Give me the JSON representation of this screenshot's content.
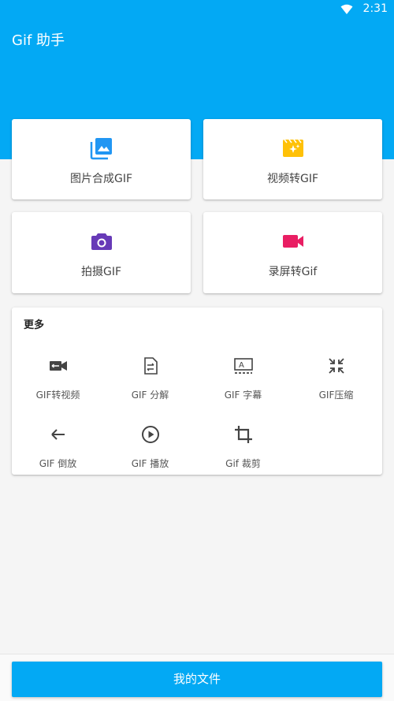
{
  "status_bar": {
    "time": "2:31",
    "wifi_icon": "wifi-icon"
  },
  "app": {
    "title": "Gif 助手"
  },
  "tiles": [
    {
      "label": "图片合成GIF",
      "icon": "photo-library-icon",
      "color": "#2196f3"
    },
    {
      "label": "视频转GIF",
      "icon": "movie-sparkle-icon",
      "color": "#ffc107"
    },
    {
      "label": "拍摄GIF",
      "icon": "camera-icon",
      "color": "#673ab7"
    },
    {
      "label": "录屏转Gif",
      "icon": "videocam-icon",
      "color": "#e91e63"
    }
  ],
  "more": {
    "title": "更多",
    "tools": [
      {
        "label": "GIF转视频",
        "icon": "video-convert-icon"
      },
      {
        "label": "GIF 分解",
        "icon": "split-file-icon"
      },
      {
        "label": "GIF 字幕",
        "icon": "subtitle-icon"
      },
      {
        "label": "GIF压缩",
        "icon": "compress-icon"
      },
      {
        "label": "GIF 倒放",
        "icon": "arrow-back-icon"
      },
      {
        "label": "GIF 播放",
        "icon": "play-circle-icon"
      },
      {
        "label": "Gif 裁剪",
        "icon": "crop-icon"
      }
    ]
  },
  "bottom": {
    "my_files_label": "我的文件"
  },
  "colors": {
    "primary": "#03a9f4",
    "background": "#f5f5f5"
  }
}
